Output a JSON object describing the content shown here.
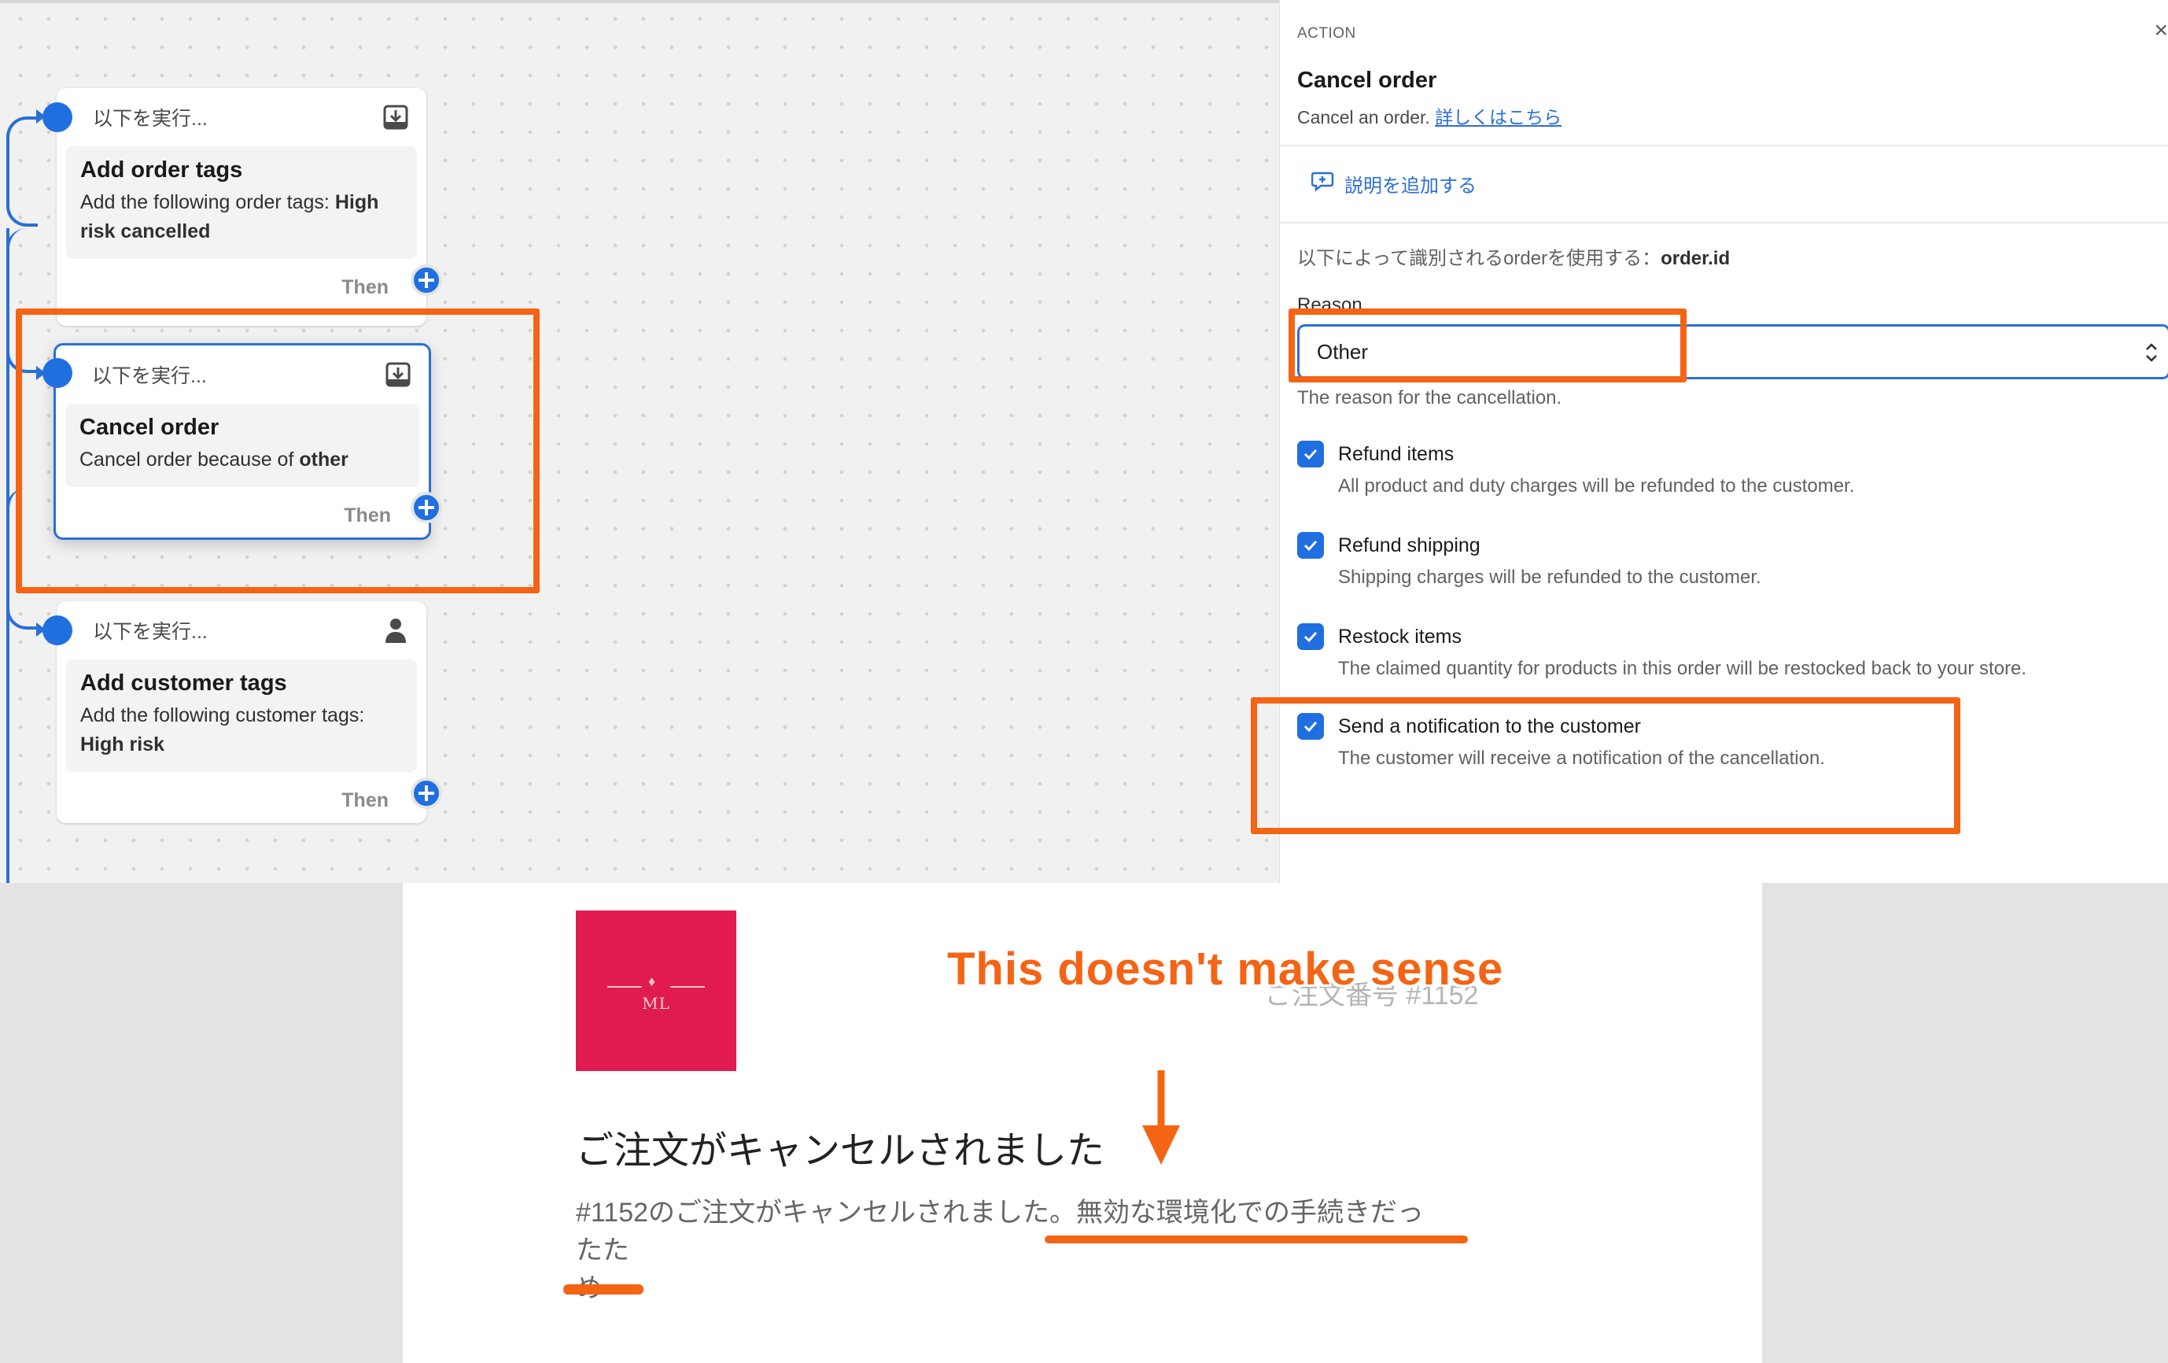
{
  "canvas": {
    "nodes": [
      {
        "header": "以下を実行...",
        "header_icon": "download-icon",
        "title": "Add order tags",
        "desc_prefix": "Add the following order tags: ",
        "desc_bold": "High risk cancelled",
        "then": "Then"
      },
      {
        "header": "以下を実行...",
        "header_icon": "download-icon",
        "title": "Cancel order",
        "desc_prefix": "Cancel order because of ",
        "desc_bold": "other",
        "then": "Then"
      },
      {
        "header": "以下を実行...",
        "header_icon": "person-icon",
        "title": "Add customer tags",
        "desc_prefix": "Add the following customer tags: ",
        "desc_bold": "High risk",
        "then": "Then"
      }
    ]
  },
  "panel": {
    "section_label": "ACTION",
    "close": "×",
    "title": "Cancel order",
    "subtitle_text": "Cancel an order. ",
    "subtitle_link": "詳しくはこちら",
    "add_description": "説明を追加する",
    "identifier_prefix": "以下によって識別されるorderを使用する：",
    "identifier_value": "order.id",
    "reason_label": "Reason",
    "reason_value": "Other",
    "reason_help": "The reason for the cancellation.",
    "checkboxes": [
      {
        "label": "Refund items",
        "help": "All product and duty charges will be refunded to the customer.",
        "checked": true
      },
      {
        "label": "Refund shipping",
        "help": "Shipping charges will be refunded to the customer.",
        "checked": true
      },
      {
        "label": "Restock items",
        "help": "The claimed quantity for products in this order will be restocked back to your store.",
        "checked": true
      },
      {
        "label": "Send a notification to the customer",
        "help": "The customer will receive a notification of the cancellation.",
        "checked": true
      }
    ]
  },
  "email": {
    "logo_text": "ML",
    "order_number": "ご注文番号 #1152",
    "heading": "ご注文がキャンセルされました",
    "body_line1": "#1152のご注文がキャンセルされました。無効な環境化での手続きだったた",
    "body_line2": "め"
  },
  "annotation": {
    "text": "This doesn't make sense",
    "color": "#f46414"
  },
  "colors": {
    "accent": "#1f6fe0",
    "highlight": "#f46414",
    "logo_bg": "#e11b4f"
  }
}
